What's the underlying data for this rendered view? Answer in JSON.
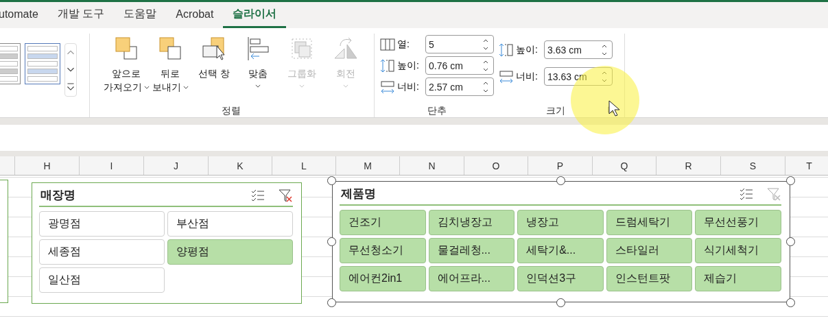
{
  "tabs": [
    {
      "label": "utomate",
      "selected": false
    },
    {
      "label": "개발 도구",
      "selected": false
    },
    {
      "label": "도움말",
      "selected": false
    },
    {
      "label": "Acrobat",
      "selected": false
    },
    {
      "label": "슬라이서",
      "selected": true
    }
  ],
  "ribbon": {
    "arrange": {
      "label": "정렬",
      "buttons": [
        {
          "kind": "bring-forward",
          "lines": [
            "앞으로",
            "가져오기"
          ],
          "dropdown": true,
          "disabled": false
        },
        {
          "kind": "send-backward",
          "lines": [
            "뒤로",
            "보내기"
          ],
          "dropdown": true,
          "disabled": false
        },
        {
          "kind": "selection-pane",
          "lines": [
            "선택 창"
          ],
          "dropdown": false,
          "disabled": false
        },
        {
          "kind": "align",
          "lines": [
            "맞춤"
          ],
          "dropdown": true,
          "disabled": false
        },
        {
          "kind": "group",
          "lines": [
            "그룹화"
          ],
          "dropdown": true,
          "disabled": true
        },
        {
          "kind": "rotate",
          "lines": [
            "회전"
          ],
          "dropdown": true,
          "disabled": true
        }
      ]
    },
    "buttons": {
      "label": "단추",
      "fields": [
        {
          "kind": "columns",
          "label": "열:",
          "value": "5"
        },
        {
          "kind": "height",
          "label": "높이:",
          "value": "0.76 cm"
        },
        {
          "kind": "width",
          "label": "너비:",
          "value": "2.57 cm"
        }
      ]
    },
    "size": {
      "label": "크기",
      "fields": [
        {
          "kind": "height",
          "label": "높이:",
          "value": "3.63 cm"
        },
        {
          "kind": "width",
          "label": "너비:",
          "value": "13.63 cm"
        }
      ]
    }
  },
  "columns": [
    "H",
    "I",
    "J",
    "K",
    "L",
    "M",
    "N",
    "O",
    "P",
    "Q",
    "R",
    "S",
    "T"
  ],
  "slicers": [
    {
      "title": "매장명",
      "selected_frame": false,
      "filtered": true,
      "items": [
        {
          "label": "광명점",
          "selected": false
        },
        {
          "label": "부산점",
          "selected": false
        },
        {
          "label": "세종점",
          "selected": false
        },
        {
          "label": "양평점",
          "selected": true
        },
        {
          "label": "일산점",
          "selected": false
        }
      ]
    },
    {
      "title": "제품명",
      "selected_frame": true,
      "filtered": false,
      "items": [
        {
          "label": "건조기",
          "selected": true
        },
        {
          "label": "김치냉장고",
          "selected": true
        },
        {
          "label": "냉장고",
          "selected": true
        },
        {
          "label": "드럼세탁기",
          "selected": true
        },
        {
          "label": "무선선풍기",
          "selected": true
        },
        {
          "label": "무선청소기",
          "selected": true
        },
        {
          "label": "물걸레청...",
          "selected": true
        },
        {
          "label": "세탁기&...",
          "selected": true
        },
        {
          "label": "스타일러",
          "selected": true
        },
        {
          "label": "식기세척기",
          "selected": true
        },
        {
          "label": "에어컨2in1",
          "selected": true
        },
        {
          "label": "에어프라...",
          "selected": true
        },
        {
          "label": "인덕션3구",
          "selected": true
        },
        {
          "label": "인스턴트팟",
          "selected": true
        },
        {
          "label": "제습기",
          "selected": true
        }
      ]
    }
  ]
}
